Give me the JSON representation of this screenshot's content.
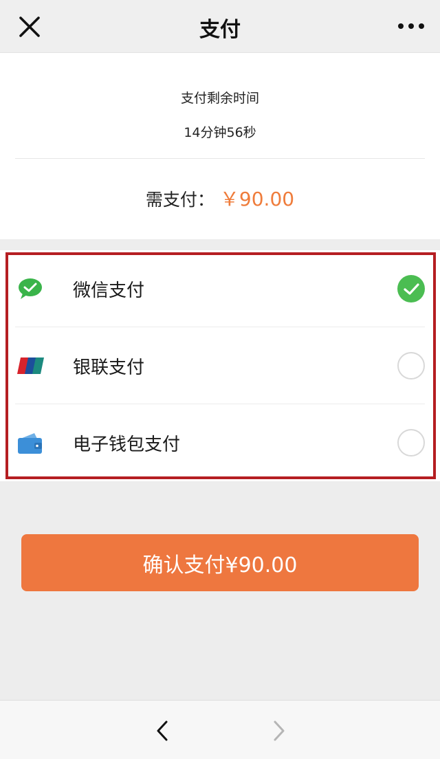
{
  "header": {
    "title": "支付",
    "close_icon": "close-icon",
    "more_icon": "more-dots-icon"
  },
  "summary": {
    "timer_label": "支付剩余时间",
    "timer_value": "14分钟56秒",
    "amount_label": "需支付：",
    "amount_value": "￥90.00"
  },
  "payment_methods": [
    {
      "label": "微信支付",
      "icon": "wechat-pay-icon",
      "selected": true
    },
    {
      "label": "银联支付",
      "icon": "unionpay-icon",
      "selected": false
    },
    {
      "label": "电子钱包支付",
      "icon": "wallet-icon",
      "selected": false
    }
  ],
  "confirm": {
    "label": "确认支付¥90.00"
  },
  "bottom_nav": {
    "back_icon": "back-arrow-icon",
    "forward_icon": "forward-arrow-icon"
  },
  "colors": {
    "accent": "#ee773f",
    "amount_text": "#ef7c3b",
    "selected_check": "#4bbd52",
    "highlight_border": "#b51e22"
  }
}
